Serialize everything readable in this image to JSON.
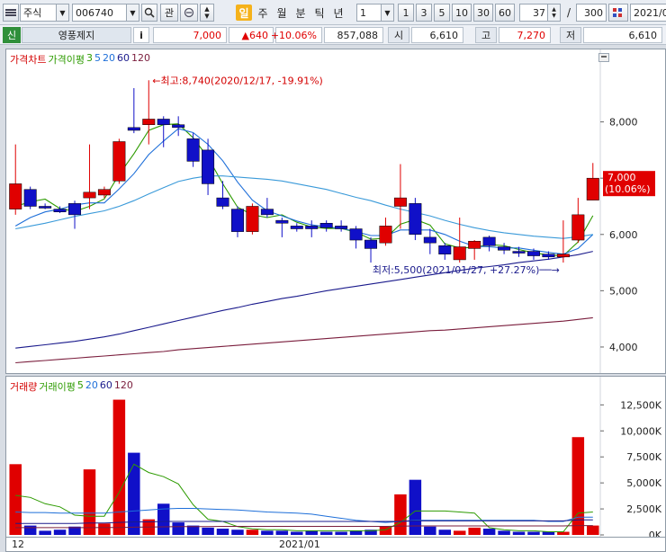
{
  "toolbar": {
    "menu_icon": "list-icon",
    "market_type": "주식",
    "stock_code": "006740",
    "watch_label": "관",
    "period_buttons": [
      "일",
      "주",
      "월",
      "분",
      "틱",
      "년"
    ],
    "interval_value": "1",
    "interval_buttons": [
      "1",
      "3",
      "5",
      "10",
      "30",
      "60"
    ],
    "count_value": "37",
    "separator": "/",
    "total_value": "300",
    "date_value": "2021/0"
  },
  "info": {
    "badge": "신",
    "stock_name": "영풍제지",
    "info_button": "i",
    "price": "7,000",
    "change": "▲640",
    "change_pct": "+10.06%",
    "volume": "857,088",
    "open_label": "시",
    "open_value": "6,610",
    "high_label": "고",
    "high_value": "7,270",
    "low_label": "저",
    "low_value": "6,610"
  },
  "price_legend": {
    "title": "가격차트",
    "ma_label": "가격이평",
    "ma_periods": [
      "3",
      "5",
      "20",
      "60",
      "120"
    ]
  },
  "volume_legend": {
    "title": "거래량",
    "ma_label": "거래이평",
    "ma_periods": [
      "5",
      "20",
      "60",
      "120"
    ]
  },
  "annotations": {
    "high": "←최고:8,740(2020/12/17, -19.91%)",
    "low": "최저:5,500(2021/01/27, +27.27%)──→",
    "last_price": "7,000",
    "last_pct": "(10.06%)"
  },
  "x_labels": {
    "left": "12",
    "month": "2021/01"
  },
  "colors": {
    "up": "#e00000",
    "down": "#1010c8",
    "ma3": "#2d9b00",
    "ma5": "#1e6fd9",
    "ma20": "#3a9ad9",
    "ma60": "#1a1a8c",
    "ma120": "#7a1d3c"
  },
  "chart_data": [
    {
      "type": "candlestick",
      "title": "가격차트",
      "ylim": [
        3600,
        9000
      ],
      "yticks": [
        "8,000",
        "7,000",
        "6,000",
        "5,000",
        "4,000"
      ],
      "ytick_values": [
        8000,
        7000,
        6000,
        5000,
        4000
      ],
      "candles": [
        {
          "o": 6450,
          "h": 7600,
          "l": 6350,
          "c": 6900
        },
        {
          "o": 6800,
          "h": 6850,
          "l": 6450,
          "c": 6500
        },
        {
          "o": 6500,
          "h": 6550,
          "l": 6450,
          "c": 6480
        },
        {
          "o": 6450,
          "h": 6500,
          "l": 6380,
          "c": 6400
        },
        {
          "o": 6550,
          "h": 6600,
          "l": 6100,
          "c": 6350
        },
        {
          "o": 6650,
          "h": 7600,
          "l": 6450,
          "c": 6750
        },
        {
          "o": 6700,
          "h": 6850,
          "l": 6650,
          "c": 6800
        },
        {
          "o": 6950,
          "h": 7700,
          "l": 6900,
          "c": 7650
        },
        {
          "o": 7900,
          "h": 8600,
          "l": 7800,
          "c": 7850
        },
        {
          "o": 7950,
          "h": 8740,
          "l": 7600,
          "c": 8050
        },
        {
          "o": 8050,
          "h": 8100,
          "l": 7550,
          "c": 7950
        },
        {
          "o": 7950,
          "h": 8100,
          "l": 7750,
          "c": 7900
        },
        {
          "o": 7700,
          "h": 7800,
          "l": 7200,
          "c": 7300
        },
        {
          "o": 7500,
          "h": 7700,
          "l": 6700,
          "c": 6900
        },
        {
          "o": 6650,
          "h": 6950,
          "l": 6450,
          "c": 6500
        },
        {
          "o": 6450,
          "h": 6500,
          "l": 5950,
          "c": 6050
        },
        {
          "o": 6050,
          "h": 6550,
          "l": 6000,
          "c": 6500
        },
        {
          "o": 6450,
          "h": 6650,
          "l": 6300,
          "c": 6350
        },
        {
          "o": 6250,
          "h": 6300,
          "l": 5950,
          "c": 6200
        },
        {
          "o": 6150,
          "h": 6200,
          "l": 6050,
          "c": 6100
        },
        {
          "o": 6150,
          "h": 6250,
          "l": 5950,
          "c": 6100
        },
        {
          "o": 6200,
          "h": 6250,
          "l": 6050,
          "c": 6120
        },
        {
          "o": 6150,
          "h": 6250,
          "l": 6050,
          "c": 6100
        },
        {
          "o": 6100,
          "h": 6150,
          "l": 5750,
          "c": 5900
        },
        {
          "o": 5900,
          "h": 5950,
          "l": 5500,
          "c": 5750
        },
        {
          "o": 5850,
          "h": 6300,
          "l": 5800,
          "c": 6150
        },
        {
          "o": 6500,
          "h": 7250,
          "l": 6100,
          "c": 6650
        },
        {
          "o": 6550,
          "h": 6650,
          "l": 5900,
          "c": 6000
        },
        {
          "o": 5950,
          "h": 6100,
          "l": 5650,
          "c": 5850
        },
        {
          "o": 5800,
          "h": 5850,
          "l": 5550,
          "c": 5650
        },
        {
          "o": 5550,
          "h": 6300,
          "l": 5500,
          "c": 5780
        },
        {
          "o": 5750,
          "h": 5900,
          "l": 5550,
          "c": 5880
        },
        {
          "o": 5950,
          "h": 5980,
          "l": 5700,
          "c": 5800
        },
        {
          "o": 5780,
          "h": 5850,
          "l": 5650,
          "c": 5720
        },
        {
          "o": 5700,
          "h": 5780,
          "l": 5600,
          "c": 5680
        },
        {
          "o": 5700,
          "h": 5750,
          "l": 5550,
          "c": 5620
        },
        {
          "o": 5650,
          "h": 5700,
          "l": 5550,
          "c": 5600
        },
        {
          "o": 5600,
          "h": 6250,
          "l": 5500,
          "c": 5650
        },
        {
          "o": 5900,
          "h": 6650,
          "l": 5850,
          "c": 6350
        },
        {
          "o": 6610,
          "h": 7270,
          "l": 6610,
          "c": 7000
        }
      ],
      "ma": [
        {
          "name": "3",
          "values": [
            6500,
            6580,
            6627,
            6460,
            6410,
            6500,
            6633,
            7067,
            7433,
            7850,
            7950,
            7967,
            7717,
            7367,
            6900,
            6483,
            6350,
            6300,
            6350,
            6217,
            6133,
            6107,
            6107,
            6040,
            5917,
            5933,
            6183,
            6267,
            6167,
            5833,
            5760,
            5770,
            5820,
            5800,
            5733,
            5673,
            5633,
            5623,
            5867,
            6333
          ]
        },
        {
          "name": "5",
          "values": [
            6150,
            6300,
            6400,
            6450,
            6526,
            6560,
            6560,
            6810,
            7080,
            7420,
            7660,
            7880,
            7810,
            7600,
            7310,
            6930,
            6610,
            6420,
            6330,
            6240,
            6170,
            6130,
            6110,
            6050,
            5980,
            5980,
            6080,
            6080,
            6080,
            6000,
            5880,
            5790,
            5780,
            5760,
            5760,
            5720,
            5680,
            5650,
            5750,
            6000
          ]
        },
        {
          "name": "20",
          "values": [
            6100,
            6150,
            6200,
            6260,
            6320,
            6370,
            6420,
            6500,
            6600,
            6720,
            6830,
            6940,
            7000,
            7040,
            7040,
            7020,
            7000,
            6980,
            6950,
            6900,
            6850,
            6800,
            6730,
            6660,
            6600,
            6520,
            6450,
            6390,
            6330,
            6250,
            6180,
            6120,
            6070,
            6030,
            6000,
            5970,
            5950,
            5930,
            5960,
            6000
          ]
        },
        {
          "name": "60",
          "values": [
            3980,
            4010,
            4040,
            4070,
            4100,
            4140,
            4180,
            4230,
            4290,
            4350,
            4410,
            4470,
            4530,
            4590,
            4650,
            4700,
            4760,
            4810,
            4860,
            4900,
            4950,
            5000,
            5040,
            5080,
            5120,
            5160,
            5200,
            5240,
            5280,
            5320,
            5360,
            5400,
            5430,
            5460,
            5500,
            5530,
            5560,
            5600,
            5640,
            5700
          ]
        },
        {
          "name": "120",
          "values": [
            3720,
            3740,
            3760,
            3780,
            3800,
            3820,
            3840,
            3860,
            3880,
            3900,
            3920,
            3950,
            3970,
            3990,
            4010,
            4030,
            4050,
            4070,
            4090,
            4110,
            4130,
            4150,
            4170,
            4190,
            4210,
            4230,
            4250,
            4270,
            4290,
            4300,
            4320,
            4340,
            4360,
            4380,
            4400,
            4420,
            4440,
            4460,
            4490,
            4520
          ]
        }
      ],
      "high_point": {
        "value": 8740,
        "date": "2020/12/17",
        "pct": -19.91
      },
      "low_point": {
        "value": 5500,
        "date": "2021/01/27",
        "pct": 27.27
      }
    },
    {
      "type": "bar",
      "title": "거래량",
      "ylim": [
        0,
        14000
      ],
      "yticks": [
        "12,500K",
        "10,000K",
        "7,500K",
        "5,000K",
        "2,500K",
        "0K"
      ],
      "ytick_values": [
        12500,
        10000,
        7500,
        5000,
        2500,
        0
      ],
      "unit": "K",
      "values": [
        6800,
        900,
        400,
        500,
        800,
        6300,
        1100,
        13000,
        7900,
        1500,
        3000,
        1200,
        900,
        700,
        600,
        500,
        500,
        400,
        400,
        300,
        400,
        300,
        300,
        400,
        500,
        800,
        3900,
        5300,
        800,
        500,
        400,
        700,
        600,
        400,
        300,
        300,
        300,
        300,
        9400,
        900
      ],
      "ma": [
        {
          "name": "5",
          "values": [
            3800,
            3600,
            3000,
            2700,
            1900,
            1800,
            1800,
            4100,
            6800,
            6000,
            5600,
            4900,
            2900,
            1500,
            1300,
            800,
            600,
            500,
            500,
            400,
            400,
            400,
            400,
            400,
            400,
            500,
            1200,
            2300,
            2300,
            2300,
            2200,
            2100,
            700,
            500,
            400,
            400,
            300,
            300,
            2100,
            2200
          ]
        },
        {
          "name": "20",
          "values": [
            2200,
            2150,
            2150,
            2100,
            2100,
            2100,
            2100,
            2200,
            2300,
            2400,
            2500,
            2550,
            2550,
            2500,
            2450,
            2400,
            2300,
            2200,
            2150,
            2100,
            2000,
            1800,
            1600,
            1400,
            1300,
            1200,
            1300,
            1400,
            1400,
            1400,
            1400,
            1400,
            1400,
            1400,
            1400,
            1400,
            1300,
            1300,
            1700,
            1700
          ]
        },
        {
          "name": "60",
          "values": [
            1100,
            1100,
            1100,
            1100,
            1100,
            1150,
            1150,
            1200,
            1250,
            1250,
            1300,
            1300,
            1300,
            1300,
            1300,
            1300,
            1300,
            1300,
            1300,
            1300,
            1300,
            1300,
            1300,
            1300,
            1300,
            1300,
            1300,
            1350,
            1350,
            1350,
            1350,
            1350,
            1350,
            1350,
            1350,
            1350,
            1350,
            1350,
            1450,
            1450
          ]
        },
        {
          "name": "120",
          "values": [
            700,
            700,
            700,
            700,
            700,
            700,
            720,
            720,
            740,
            760,
            780,
            800,
            800,
            800,
            820,
            820,
            820,
            820,
            820,
            820,
            820,
            820,
            820,
            820,
            820,
            820,
            840,
            860,
            860,
            860,
            860,
            860,
            860,
            860,
            860,
            860,
            860,
            860,
            900,
            900
          ]
        }
      ]
    }
  ]
}
